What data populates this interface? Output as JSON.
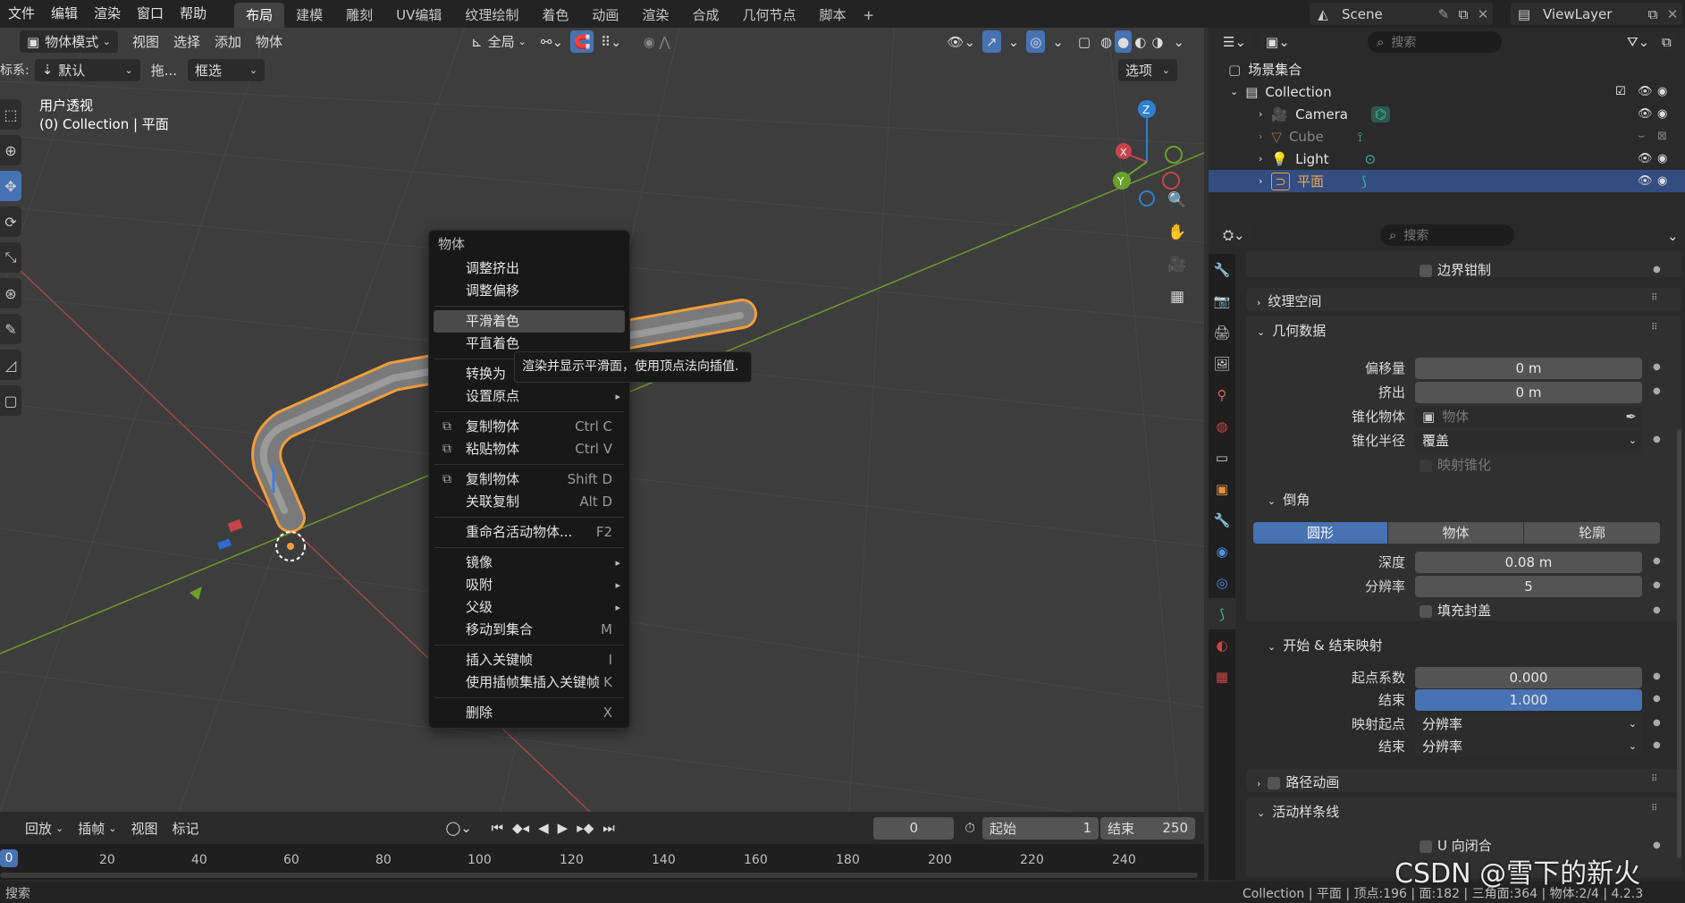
{
  "topbar": {
    "menus": [
      "文件",
      "编辑",
      "渲染",
      "窗口",
      "帮助"
    ],
    "workspaces": [
      "布局",
      "建模",
      "雕刻",
      "UV编辑",
      "纹理绘制",
      "着色",
      "动画",
      "渲染",
      "合成",
      "几何节点",
      "脚本"
    ],
    "add_tab": "+",
    "scene_name": "Scene",
    "viewlayer_name": "ViewLayer"
  },
  "viewport": {
    "mode": "物体模式",
    "menus": [
      "视图",
      "选择",
      "添加",
      "物体"
    ],
    "orientation": "全局",
    "coord_label": "标系:",
    "drag_value": "默认",
    "drag_label": "拖...",
    "select_box": "框选",
    "options": "选项",
    "view_name": "用户透视",
    "collection_info": "(0) Collection | 平面",
    "axis": {
      "x": "X",
      "y": "Y",
      "z": "Z"
    }
  },
  "context_menu": {
    "title": "物体",
    "items": [
      {
        "label": "调整挤出",
        "shortcut": ""
      },
      {
        "label": "调整偏移",
        "shortcut": ""
      },
      {
        "sep": true
      },
      {
        "label": "平滑着色",
        "shortcut": "",
        "highlight": true
      },
      {
        "label": "平直着色",
        "shortcut": ""
      },
      {
        "sep": true
      },
      {
        "label": "转换为",
        "shortcut": ""
      },
      {
        "label": "设置原点",
        "shortcut": "",
        "submenu": true
      },
      {
        "sep": true
      },
      {
        "label": "复制物体",
        "shortcut": "Ctrl C",
        "icon": "copy-icon"
      },
      {
        "label": "粘贴物体",
        "shortcut": "Ctrl V",
        "icon": "paste-icon"
      },
      {
        "sep": true
      },
      {
        "label": "复制物体",
        "shortcut": "Shift D",
        "icon": "duplicate-icon"
      },
      {
        "label": "关联复制",
        "shortcut": "Alt D"
      },
      {
        "sep": true
      },
      {
        "label": "重命名活动物体...",
        "shortcut": "F2"
      },
      {
        "sep": true
      },
      {
        "label": "镜像",
        "shortcut": "",
        "submenu": true
      },
      {
        "label": "吸附",
        "shortcut": "",
        "submenu": true
      },
      {
        "label": "父级",
        "shortcut": "",
        "submenu": true
      },
      {
        "label": "移动到集合",
        "shortcut": "M"
      },
      {
        "sep": true
      },
      {
        "label": "插入关键帧",
        "shortcut": "I"
      },
      {
        "label": "使用插帧集插入关键帧",
        "shortcut": "K"
      },
      {
        "sep": true
      },
      {
        "label": "删除",
        "shortcut": "X"
      }
    ]
  },
  "tooltip": "渲染并显示平滑面，使用顶点法向插值.",
  "timeline": {
    "playback": "回放",
    "keying": "插帧",
    "view": "视图",
    "marker": "标记",
    "current_frame": "0",
    "start_label": "起始",
    "start_value": "1",
    "end_label": "结束",
    "end_value": "250",
    "ruler": [
      "0",
      "20",
      "40",
      "60",
      "80",
      "100",
      "120",
      "140",
      "160",
      "180",
      "200",
      "220",
      "240"
    ]
  },
  "outliner": {
    "search_placeholder": "搜索",
    "rows": [
      {
        "label": "场景集合"
      },
      {
        "label": "Collection"
      },
      {
        "label": "Camera"
      },
      {
        "label": "Cube"
      },
      {
        "label": "Light"
      },
      {
        "label": "平面"
      }
    ]
  },
  "properties": {
    "search_placeholder": "搜索",
    "boundary_clamp": "边界钳制",
    "texture_space": "纹理空间",
    "geometry": "几何数据",
    "offset_label": "偏移量",
    "offset_value": "0 m",
    "extrude_label": "挤出",
    "extrude_value": "0 m",
    "taper_obj_label": "锥化物体",
    "taper_obj_placeholder": "物体",
    "taper_radius_label": "锥化半径",
    "taper_radius_value": "覆盖",
    "map_taper": "映射锥化",
    "bevel": "倒角",
    "bevel_modes": [
      "圆形",
      "物体",
      "轮廓"
    ],
    "depth_label": "深度",
    "depth_value": "0.08 m",
    "resolution_label": "分辨率",
    "resolution_value": "5",
    "fill_caps": "填充封盖",
    "start_end_map": "开始 & 结束映射",
    "start_factor_label": "起点系数",
    "start_factor_value": "0.000",
    "end_label": "结束",
    "end_value": "1.000",
    "map_start_label": "映射起点",
    "map_start_value": "分辨率",
    "map_end_label": "结束",
    "map_end_value": "分辨率",
    "path_anim": "路径动画",
    "active_spline": "活动样条线",
    "u_cyclic": "U 向闭合"
  },
  "statusbar": {
    "search": "搜索",
    "stats": "Collection | 平面 | 顶点:196 | 面:182 | 三角面:364 | 物体:2/4 | 4.2.3"
  },
  "watermark": "CSDN @雪下的新火",
  "colors": {
    "accent": "#4772b3",
    "selection_orange": "#f29d3a",
    "x_axis": "#c9434b",
    "y_axis": "#6aa12a",
    "z_axis": "#2f80cf"
  }
}
